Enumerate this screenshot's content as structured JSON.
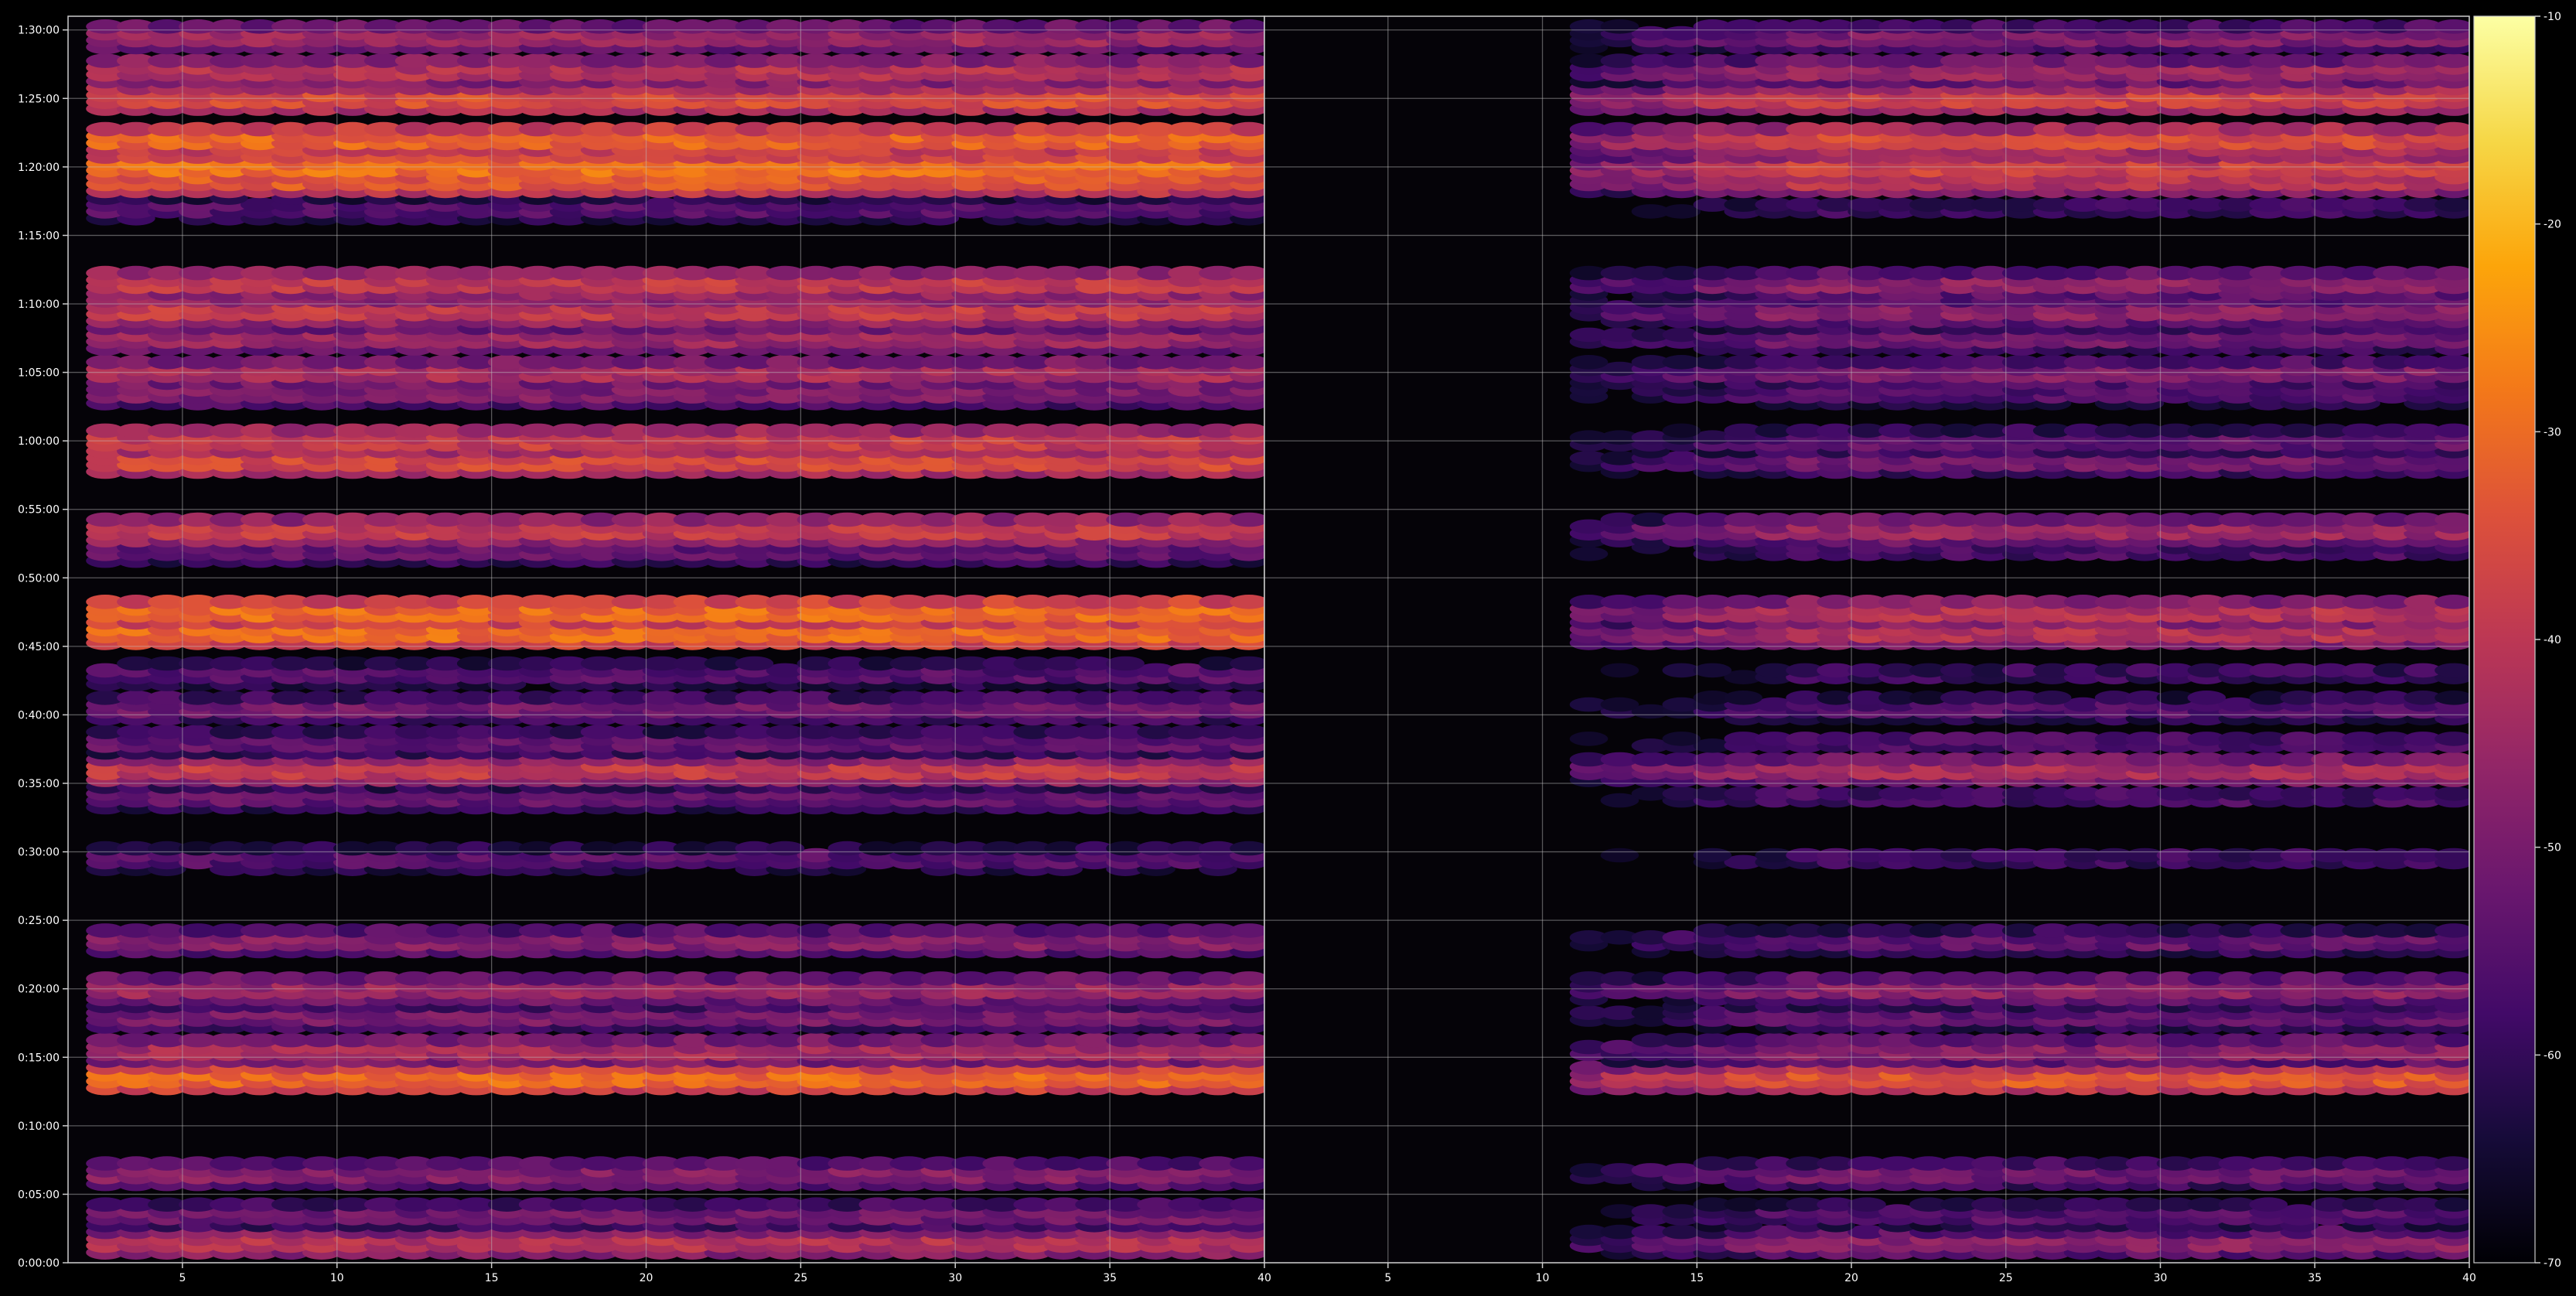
{
  "chart_data": [
    {
      "type": "heatmap",
      "panel": "left",
      "title": "",
      "xlabel": "",
      "ylabel": "",
      "x_ticks": [
        "5",
        "10",
        "15",
        "20",
        "25",
        "30",
        "35",
        "40"
      ],
      "x_tick_values": [
        5,
        10,
        15,
        20,
        25,
        30,
        35,
        40
      ],
      "xlim": [
        1.3,
        40
      ],
      "y_ticks": [
        "0:00:00",
        "0:05:00",
        "0:10:00",
        "0:15:00",
        "0:20:00",
        "0:25:00",
        "0:30:00",
        "0:35:00",
        "0:40:00",
        "0:45:00",
        "0:50:00",
        "0:55:00",
        "1:00:00",
        "1:05:00",
        "1:10:00",
        "1:15:00",
        "1:20:00",
        "1:25:00",
        "1:30:00"
      ],
      "y_tick_values": [
        0,
        5,
        10,
        15,
        20,
        25,
        30,
        35,
        40,
        45,
        50,
        55,
        60,
        65,
        70,
        75,
        80,
        85,
        90
      ],
      "ylim": [
        0,
        91
      ],
      "grid": true,
      "x_range_with_data": [
        2,
        39
      ],
      "bands": [
        {
          "time": "0:01:30",
          "level": -38
        },
        {
          "time": "0:03:30",
          "level": -48
        },
        {
          "time": "0:06:30",
          "level": -45
        },
        {
          "time": "0:13:30",
          "level": -27
        },
        {
          "time": "0:15:30",
          "level": -40
        },
        {
          "time": "0:18:00",
          "level": -47
        },
        {
          "time": "0:20:00",
          "level": -42
        },
        {
          "time": "0:23:30",
          "level": -45
        },
        {
          "time": "0:29:30",
          "level": -52
        },
        {
          "time": "0:34:00",
          "level": -50
        },
        {
          "time": "0:36:00",
          "level": -36
        },
        {
          "time": "0:38:00",
          "level": -50
        },
        {
          "time": "0:40:30",
          "level": -48
        },
        {
          "time": "0:43:00",
          "level": -52
        },
        {
          "time": "0:46:00",
          "level": -27
        },
        {
          "time": "0:47:30",
          "level": -27
        },
        {
          "time": "0:52:00",
          "level": -50
        },
        {
          "time": "0:53:30",
          "level": -36
        },
        {
          "time": "0:58:30",
          "level": -33
        },
        {
          "time": "1:00:00",
          "level": -35
        },
        {
          "time": "1:03:30",
          "level": -46
        },
        {
          "time": "1:05:00",
          "level": -40
        },
        {
          "time": "1:07:30",
          "level": -42
        },
        {
          "time": "1:09:30",
          "level": -36
        },
        {
          "time": "1:11:30",
          "level": -36
        },
        {
          "time": "1:17:00",
          "level": -52
        },
        {
          "time": "1:19:00",
          "level": -30
        },
        {
          "time": "1:20:00",
          "level": -26
        },
        {
          "time": "1:22:00",
          "level": -28
        },
        {
          "time": "1:25:00",
          "level": -32
        },
        {
          "time": "1:27:00",
          "level": -38
        },
        {
          "time": "1:29:30",
          "level": -42
        }
      ]
    },
    {
      "type": "heatmap",
      "panel": "right",
      "title": "",
      "xlabel": "",
      "ylabel": "",
      "x_ticks": [
        "5",
        "10",
        "15",
        "20",
        "25",
        "30",
        "35",
        "40"
      ],
      "x_tick_values": [
        5,
        10,
        15,
        20,
        25,
        30,
        35,
        40
      ],
      "xlim": [
        1,
        40
      ],
      "y_ticks": [],
      "ylim": [
        0,
        91
      ],
      "grid": true,
      "x_range_with_data": [
        11,
        39
      ],
      "bands": [
        {
          "time": "0:01:30",
          "level": -44
        },
        {
          "time": "0:03:30",
          "level": -52
        },
        {
          "time": "0:06:30",
          "level": -48
        },
        {
          "time": "0:13:30",
          "level": -30
        },
        {
          "time": "0:15:30",
          "level": -44
        },
        {
          "time": "0:18:00",
          "level": -50
        },
        {
          "time": "0:20:00",
          "level": -44
        },
        {
          "time": "0:23:30",
          "level": -50
        },
        {
          "time": "0:29:30",
          "level": -56
        },
        {
          "time": "0:34:00",
          "level": -54
        },
        {
          "time": "0:36:00",
          "level": -40
        },
        {
          "time": "0:38:00",
          "level": -54
        },
        {
          "time": "0:40:30",
          "level": -52
        },
        {
          "time": "0:43:00",
          "level": -56
        },
        {
          "time": "0:46:00",
          "level": -38
        },
        {
          "time": "0:47:30",
          "level": -38
        },
        {
          "time": "0:52:00",
          "level": -54
        },
        {
          "time": "0:53:30",
          "level": -42
        },
        {
          "time": "0:58:30",
          "level": -48
        },
        {
          "time": "1:00:00",
          "level": -50
        },
        {
          "time": "1:03:30",
          "level": -52
        },
        {
          "time": "1:05:00",
          "level": -46
        },
        {
          "time": "1:07:30",
          "level": -48
        },
        {
          "time": "1:09:30",
          "level": -44
        },
        {
          "time": "1:11:30",
          "level": -44
        },
        {
          "time": "1:17:00",
          "level": -56
        },
        {
          "time": "1:19:00",
          "level": -38
        },
        {
          "time": "1:20:00",
          "level": -34
        },
        {
          "time": "1:22:00",
          "level": -33
        },
        {
          "time": "1:25:00",
          "level": -34
        },
        {
          "time": "1:27:00",
          "level": -42
        },
        {
          "time": "1:29:30",
          "level": -46
        }
      ]
    }
  ],
  "colorbar": {
    "ticks": [
      "-10",
      "-20",
      "-30",
      "-40",
      "-50",
      "-60",
      "-70"
    ],
    "tick_values": [
      -10,
      -20,
      -30,
      -40,
      -50,
      -60,
      -70
    ],
    "range": [
      -70,
      -10
    ],
    "colormap": "inferno"
  },
  "colors": {
    "background": "#000000",
    "axes_face": "#050308",
    "grid": "#bfbfbf",
    "tick_text": "#ffffff",
    "spine": "#cccccc"
  }
}
